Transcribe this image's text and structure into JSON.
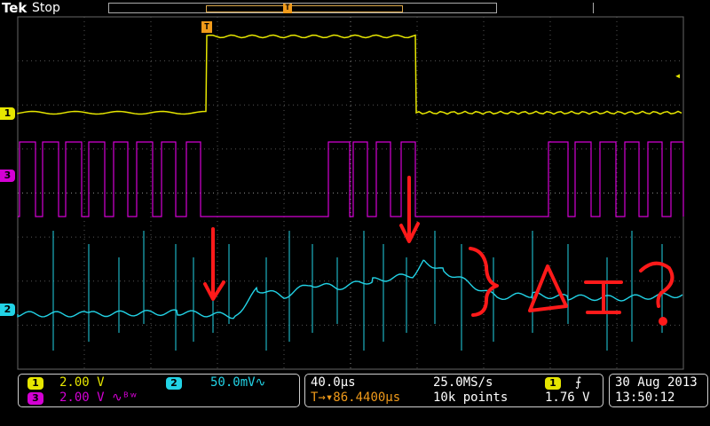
{
  "header": {
    "brand_tek": "Tek",
    "status": "Stop",
    "trigger_marker": "T"
  },
  "channels": {
    "ch1": {
      "label": "1",
      "scale": "2.00 V",
      "color": "#e6e600"
    },
    "ch2": {
      "label": "2",
      "scale": "50.0mV",
      "coupling_icon": "∿",
      "color": "#22d3e6"
    },
    "ch3": {
      "label": "3",
      "scale": "2.00 V",
      "coupling_icon": "∿ᴮʷ",
      "color": "#d400d4"
    }
  },
  "timebase": {
    "scale": "40.0µs",
    "sample_rate": "25.0MS/s",
    "trigger_icon": "T→▾",
    "trigger_position": "86.4400µs",
    "record_length": "10k points"
  },
  "trigger": {
    "source": "1",
    "slope_icon": "rising-edge-icon",
    "slope_glyph": "⨍",
    "level": "1.76 V"
  },
  "datetime": {
    "date": "30 Aug 2013",
    "time": "13:50:12"
  },
  "annotation": {
    "text": "}ΔI?",
    "color": "#ff1a1a"
  }
}
